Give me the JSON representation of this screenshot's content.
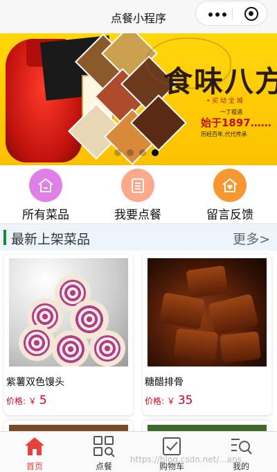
{
  "navbar": {
    "title": "点餐小程序"
  },
  "banner": {
    "slogan": "食味八方",
    "tagline": "• 买 动 全 城",
    "sub1": "一丁祖酒",
    "year_text": "始于1897……",
    "sub2": "历经百年,代代传承",
    "slide_count": 4,
    "active_slide": 4
  },
  "quick_menu": [
    {
      "label": "所有菜品",
      "icon": "house-icon",
      "color": "#e07fe6"
    },
    {
      "label": "我要点餐",
      "icon": "list-icon",
      "color": "#fba98a"
    },
    {
      "label": "留言反馈",
      "icon": "house-heart-icon",
      "color": "#f7982f"
    }
  ],
  "section": {
    "title": "最新上架菜品",
    "more": "更多>"
  },
  "products": [
    {
      "name": "紫薯双色馒头",
      "price_label": "价格: ￥",
      "price": "5"
    },
    {
      "name": "糖醋排骨",
      "price_label": "价格: ￥",
      "price": "35"
    }
  ],
  "tabbar": [
    {
      "label": "首页",
      "icon": "home-icon",
      "active": true
    },
    {
      "label": "点餐",
      "icon": "grid-search-icon",
      "active": false
    },
    {
      "label": "购物车",
      "icon": "checkbox-icon",
      "active": false
    },
    {
      "label": "我的",
      "icon": "profile-search-icon",
      "active": false
    }
  ],
  "watermark": "https://blog.csdn.net/...ans",
  "colors": {
    "accent": "#e8413a",
    "price": "#d0021b",
    "section_bar": "#1b8a2e"
  }
}
